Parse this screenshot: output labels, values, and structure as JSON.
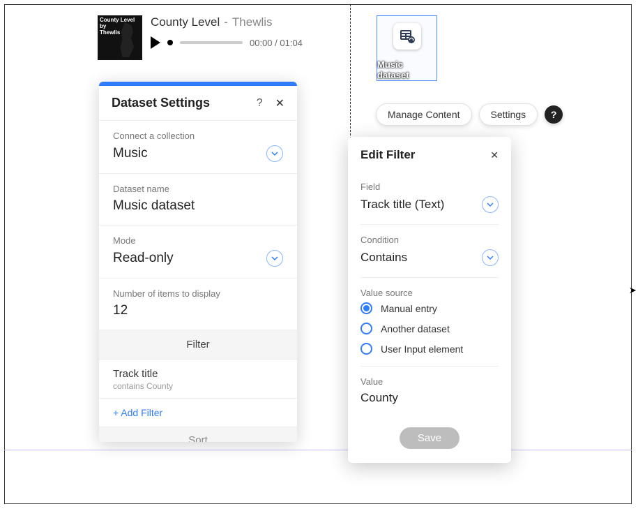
{
  "player": {
    "album_text": "County Level\nby\nThewlis",
    "title": "County Level",
    "artist": "Thewlis",
    "time": "00:00 / 01:04"
  },
  "settings_panel": {
    "title": "Dataset Settings",
    "help_glyph": "?",
    "close_glyph": "✕",
    "connect_label": "Connect a collection",
    "connect_value": "Music",
    "name_label": "Dataset name",
    "name_value": "Music dataset",
    "mode_label": "Mode",
    "mode_value": "Read-only",
    "count_label": "Number of items to display",
    "count_value": "12",
    "filter_header": "Filter",
    "filter_item_field": "Track title",
    "filter_item_desc": "contains County",
    "add_filter": "+ Add Filter",
    "sort_header": "Sort"
  },
  "dataset_node": {
    "label": "Music dataset"
  },
  "toolbar": {
    "manage": "Manage Content",
    "settings": "Settings",
    "help_glyph": "?"
  },
  "edit_filter": {
    "title": "Edit Filter",
    "close_glyph": "✕",
    "field_label": "Field",
    "field_value": "Track title (Text)",
    "condition_label": "Condition",
    "condition_value": "Contains",
    "source_label": "Value source",
    "sources": {
      "manual": "Manual entry",
      "another": "Another dataset",
      "userinput": "User Input element"
    },
    "selected_source": "manual",
    "value_label": "Value",
    "value_value": "County",
    "save": "Save"
  }
}
